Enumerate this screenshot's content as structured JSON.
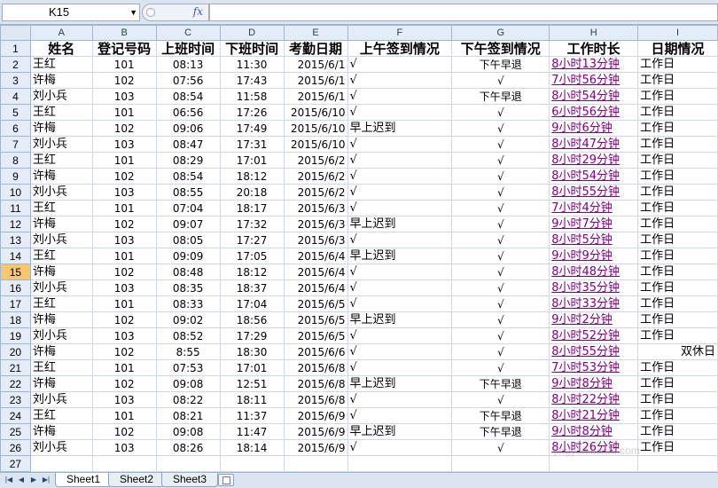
{
  "formula_bar": {
    "name_box": "K15",
    "fx_label": "fx",
    "formula": ""
  },
  "columns": [
    "A",
    "B",
    "C",
    "D",
    "E",
    "F",
    "G",
    "H",
    "I"
  ],
  "active_row": 15,
  "header_row": {
    "row_num": 1,
    "cells": [
      "姓名",
      "登记号码",
      "上班时间",
      "下班时间",
      "考勤日期",
      "上午签到情况",
      "下午签到情况",
      "工作时长",
      "日期情况"
    ]
  },
  "rows": [
    {
      "n": 2,
      "name": "王红",
      "id": "101",
      "in": "08:13",
      "out": "11:30",
      "date": "2015/6/1",
      "am": "√",
      "pm": "下午早退",
      "dur": "8小时13分钟",
      "day": "工作日"
    },
    {
      "n": 3,
      "name": "许梅",
      "id": "102",
      "in": "07:56",
      "out": "17:43",
      "date": "2015/6/1",
      "am": "√",
      "pm": "√",
      "dur": "7小时56分钟",
      "day": "工作日"
    },
    {
      "n": 4,
      "name": "刘小兵",
      "id": "103",
      "in": "08:54",
      "out": "11:58",
      "date": "2015/6/1",
      "am": "√",
      "pm": "下午早退",
      "dur": "8小时54分钟",
      "day": "工作日"
    },
    {
      "n": 5,
      "name": "王红",
      "id": "101",
      "in": "06:56",
      "out": "17:26",
      "date": "2015/6/10",
      "am": "√",
      "pm": "√",
      "dur": "6小时56分钟",
      "day": "工作日"
    },
    {
      "n": 6,
      "name": "许梅",
      "id": "102",
      "in": "09:06",
      "out": "17:49",
      "date": "2015/6/10",
      "am": "早上迟到",
      "pm": "√",
      "dur": "9小时6分钟",
      "day": "工作日"
    },
    {
      "n": 7,
      "name": "刘小兵",
      "id": "103",
      "in": "08:47",
      "out": "17:31",
      "date": "2015/6/10",
      "am": "√",
      "pm": "√",
      "dur": "8小时47分钟",
      "day": "工作日"
    },
    {
      "n": 8,
      "name": "王红",
      "id": "101",
      "in": "08:29",
      "out": "17:01",
      "date": "2015/6/2",
      "am": "√",
      "pm": "√",
      "dur": "8小时29分钟",
      "day": "工作日"
    },
    {
      "n": 9,
      "name": "许梅",
      "id": "102",
      "in": "08:54",
      "out": "18:12",
      "date": "2015/6/2",
      "am": "√",
      "pm": "√",
      "dur": "8小时54分钟",
      "day": "工作日"
    },
    {
      "n": 10,
      "name": "刘小兵",
      "id": "103",
      "in": "08:55",
      "out": "20:18",
      "date": "2015/6/2",
      "am": "√",
      "pm": "√",
      "dur": "8小时55分钟",
      "day": "工作日"
    },
    {
      "n": 11,
      "name": "王红",
      "id": "101",
      "in": "07:04",
      "out": "18:17",
      "date": "2015/6/3",
      "am": "√",
      "pm": "√",
      "dur": "7小时4分钟",
      "day": "工作日"
    },
    {
      "n": 12,
      "name": "许梅",
      "id": "102",
      "in": "09:07",
      "out": "17:32",
      "date": "2015/6/3",
      "am": "早上迟到",
      "pm": "√",
      "dur": "9小时7分钟",
      "day": "工作日"
    },
    {
      "n": 13,
      "name": "刘小兵",
      "id": "103",
      "in": "08:05",
      "out": "17:27",
      "date": "2015/6/3",
      "am": "√",
      "pm": "√",
      "dur": "8小时5分钟",
      "day": "工作日"
    },
    {
      "n": 14,
      "name": "王红",
      "id": "101",
      "in": "09:09",
      "out": "17:05",
      "date": "2015/6/4",
      "am": "早上迟到",
      "pm": "√",
      "dur": "9小时9分钟",
      "day": "工作日"
    },
    {
      "n": 15,
      "name": "许梅",
      "id": "102",
      "in": "08:48",
      "out": "18:12",
      "date": "2015/6/4",
      "am": "√",
      "pm": "√",
      "dur": "8小时48分钟",
      "day": "工作日"
    },
    {
      "n": 16,
      "name": "刘小兵",
      "id": "103",
      "in": "08:35",
      "out": "18:37",
      "date": "2015/6/4",
      "am": "√",
      "pm": "√",
      "dur": "8小时35分钟",
      "day": "工作日"
    },
    {
      "n": 17,
      "name": "王红",
      "id": "101",
      "in": "08:33",
      "out": "17:04",
      "date": "2015/6/5",
      "am": "√",
      "pm": "√",
      "dur": "8小时33分钟",
      "day": "工作日"
    },
    {
      "n": 18,
      "name": "许梅",
      "id": "102",
      "in": "09:02",
      "out": "18:56",
      "date": "2015/6/5",
      "am": "早上迟到",
      "pm": "√",
      "dur": "9小时2分钟",
      "day": "工作日"
    },
    {
      "n": 19,
      "name": "刘小兵",
      "id": "103",
      "in": "08:52",
      "out": "17:29",
      "date": "2015/6/5",
      "am": "√",
      "pm": "√",
      "dur": "8小时52分钟",
      "day": "工作日"
    },
    {
      "n": 20,
      "name": "许梅",
      "id": "102",
      "in": "8:55",
      "out": "18:30",
      "date": "2015/6/6",
      "am": "√",
      "pm": "√",
      "dur": "8小时55分钟",
      "day": "双休日",
      "off": true
    },
    {
      "n": 21,
      "name": "王红",
      "id": "101",
      "in": "07:53",
      "out": "17:01",
      "date": "2015/6/8",
      "am": "√",
      "pm": "√",
      "dur": "7小时53分钟",
      "day": "工作日"
    },
    {
      "n": 22,
      "name": "许梅",
      "id": "102",
      "in": "09:08",
      "out": "12:51",
      "date": "2015/6/8",
      "am": "早上迟到",
      "pm": "下午早退",
      "dur": "9小时8分钟",
      "day": "工作日"
    },
    {
      "n": 23,
      "name": "刘小兵",
      "id": "103",
      "in": "08:22",
      "out": "18:11",
      "date": "2015/6/8",
      "am": "√",
      "pm": "√",
      "dur": "8小时22分钟",
      "day": "工作日"
    },
    {
      "n": 24,
      "name": "王红",
      "id": "101",
      "in": "08:21",
      "out": "11:37",
      "date": "2015/6/9",
      "am": "√",
      "pm": "下午早退",
      "dur": "8小时21分钟",
      "day": "工作日"
    },
    {
      "n": 25,
      "name": "许梅",
      "id": "102",
      "in": "09:08",
      "out": "11:47",
      "date": "2015/6/9",
      "am": "早上迟到",
      "pm": "下午早退",
      "dur": "9小时8分钟",
      "day": "工作日"
    },
    {
      "n": 26,
      "name": "刘小兵",
      "id": "103",
      "in": "08:26",
      "out": "18:14",
      "date": "2015/6/9",
      "am": "√",
      "pm": "√",
      "dur": "8小时26分钟",
      "day": "工作日"
    },
    {
      "n": 27
    }
  ],
  "sheet_tabs": [
    {
      "label": "Sheet1",
      "active": true
    },
    {
      "label": "Sheet2",
      "active": false
    },
    {
      "label": "Sheet3",
      "active": false
    }
  ],
  "tab_nav": [
    "first-sheet",
    "prev-sheet",
    "next-sheet",
    "last-sheet"
  ],
  "watermark": "jingyan.baidu.com"
}
